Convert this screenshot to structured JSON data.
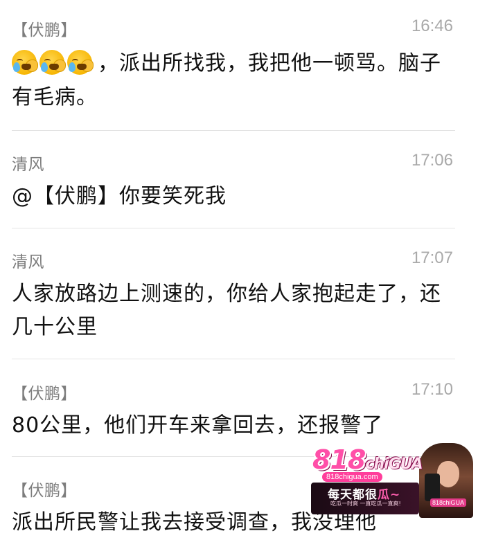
{
  "messages": [
    {
      "sender": "【伏鹏】",
      "time": "16:46",
      "emojis": [
        "loudly-crying-face-icon",
        "loudly-crying-face-icon",
        "loudly-crying-face-icon"
      ],
      "text": "，派出所找我，我把他一顿骂。脑子有毛病。"
    },
    {
      "sender": "清风",
      "time": "17:06",
      "text": "@【伏鹏】你要笑死我"
    },
    {
      "sender": "清风",
      "time": "17:07",
      "text": "人家放路边上测速的，你给人家抱起走了，还几十公里"
    },
    {
      "sender": "【伏鹏】",
      "time": "17:10",
      "text": "80公里，他们开车来拿回去，还报警了"
    },
    {
      "sender": "【伏鹏】",
      "time": "",
      "text": "派出所民警让我去接受调查，我没理他"
    }
  ],
  "watermark": {
    "logo_main": "818",
    "logo_suffix": "chiGUA",
    "url": "818chigua.com",
    "slogan_prefix": "每天都很",
    "slogan_highlight": "瓜~",
    "subtitle": "吃瓜一时爽 一直吃瓜一直爽!",
    "badge": "818chiGUA"
  },
  "colors": {
    "background": "#ffffff",
    "sender_text": "#7d7d7d",
    "time_text": "#a9a9a9",
    "message_text": "#111111",
    "divider": "#e3e3e3",
    "watermark_pink": "#ff4fa8"
  }
}
